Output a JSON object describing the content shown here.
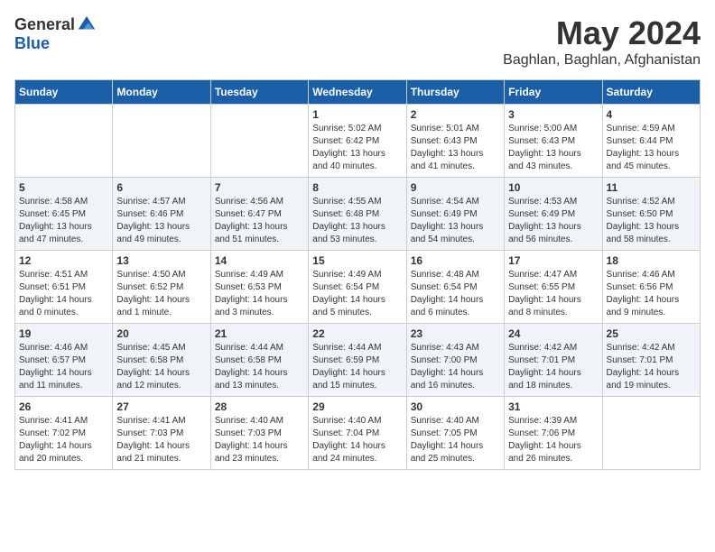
{
  "logo": {
    "general": "General",
    "blue": "Blue"
  },
  "title": "May 2024",
  "location": "Baghlan, Baghlan, Afghanistan",
  "headers": [
    "Sunday",
    "Monday",
    "Tuesday",
    "Wednesday",
    "Thursday",
    "Friday",
    "Saturday"
  ],
  "weeks": [
    [
      {
        "day": "",
        "sunrise": "",
        "sunset": "",
        "daylight": ""
      },
      {
        "day": "",
        "sunrise": "",
        "sunset": "",
        "daylight": ""
      },
      {
        "day": "",
        "sunrise": "",
        "sunset": "",
        "daylight": ""
      },
      {
        "day": "1",
        "sunrise": "Sunrise: 5:02 AM",
        "sunset": "Sunset: 6:42 PM",
        "daylight": "Daylight: 13 hours and 40 minutes."
      },
      {
        "day": "2",
        "sunrise": "Sunrise: 5:01 AM",
        "sunset": "Sunset: 6:43 PM",
        "daylight": "Daylight: 13 hours and 41 minutes."
      },
      {
        "day": "3",
        "sunrise": "Sunrise: 5:00 AM",
        "sunset": "Sunset: 6:43 PM",
        "daylight": "Daylight: 13 hours and 43 minutes."
      },
      {
        "day": "4",
        "sunrise": "Sunrise: 4:59 AM",
        "sunset": "Sunset: 6:44 PM",
        "daylight": "Daylight: 13 hours and 45 minutes."
      }
    ],
    [
      {
        "day": "5",
        "sunrise": "Sunrise: 4:58 AM",
        "sunset": "Sunset: 6:45 PM",
        "daylight": "Daylight: 13 hours and 47 minutes."
      },
      {
        "day": "6",
        "sunrise": "Sunrise: 4:57 AM",
        "sunset": "Sunset: 6:46 PM",
        "daylight": "Daylight: 13 hours and 49 minutes."
      },
      {
        "day": "7",
        "sunrise": "Sunrise: 4:56 AM",
        "sunset": "Sunset: 6:47 PM",
        "daylight": "Daylight: 13 hours and 51 minutes."
      },
      {
        "day": "8",
        "sunrise": "Sunrise: 4:55 AM",
        "sunset": "Sunset: 6:48 PM",
        "daylight": "Daylight: 13 hours and 53 minutes."
      },
      {
        "day": "9",
        "sunrise": "Sunrise: 4:54 AM",
        "sunset": "Sunset: 6:49 PM",
        "daylight": "Daylight: 13 hours and 54 minutes."
      },
      {
        "day": "10",
        "sunrise": "Sunrise: 4:53 AM",
        "sunset": "Sunset: 6:49 PM",
        "daylight": "Daylight: 13 hours and 56 minutes."
      },
      {
        "day": "11",
        "sunrise": "Sunrise: 4:52 AM",
        "sunset": "Sunset: 6:50 PM",
        "daylight": "Daylight: 13 hours and 58 minutes."
      }
    ],
    [
      {
        "day": "12",
        "sunrise": "Sunrise: 4:51 AM",
        "sunset": "Sunset: 6:51 PM",
        "daylight": "Daylight: 14 hours and 0 minutes."
      },
      {
        "day": "13",
        "sunrise": "Sunrise: 4:50 AM",
        "sunset": "Sunset: 6:52 PM",
        "daylight": "Daylight: 14 hours and 1 minute."
      },
      {
        "day": "14",
        "sunrise": "Sunrise: 4:49 AM",
        "sunset": "Sunset: 6:53 PM",
        "daylight": "Daylight: 14 hours and 3 minutes."
      },
      {
        "day": "15",
        "sunrise": "Sunrise: 4:49 AM",
        "sunset": "Sunset: 6:54 PM",
        "daylight": "Daylight: 14 hours and 5 minutes."
      },
      {
        "day": "16",
        "sunrise": "Sunrise: 4:48 AM",
        "sunset": "Sunset: 6:54 PM",
        "daylight": "Daylight: 14 hours and 6 minutes."
      },
      {
        "day": "17",
        "sunrise": "Sunrise: 4:47 AM",
        "sunset": "Sunset: 6:55 PM",
        "daylight": "Daylight: 14 hours and 8 minutes."
      },
      {
        "day": "18",
        "sunrise": "Sunrise: 4:46 AM",
        "sunset": "Sunset: 6:56 PM",
        "daylight": "Daylight: 14 hours and 9 minutes."
      }
    ],
    [
      {
        "day": "19",
        "sunrise": "Sunrise: 4:46 AM",
        "sunset": "Sunset: 6:57 PM",
        "daylight": "Daylight: 14 hours and 11 minutes."
      },
      {
        "day": "20",
        "sunrise": "Sunrise: 4:45 AM",
        "sunset": "Sunset: 6:58 PM",
        "daylight": "Daylight: 14 hours and 12 minutes."
      },
      {
        "day": "21",
        "sunrise": "Sunrise: 4:44 AM",
        "sunset": "Sunset: 6:58 PM",
        "daylight": "Daylight: 14 hours and 13 minutes."
      },
      {
        "day": "22",
        "sunrise": "Sunrise: 4:44 AM",
        "sunset": "Sunset: 6:59 PM",
        "daylight": "Daylight: 14 hours and 15 minutes."
      },
      {
        "day": "23",
        "sunrise": "Sunrise: 4:43 AM",
        "sunset": "Sunset: 7:00 PM",
        "daylight": "Daylight: 14 hours and 16 minutes."
      },
      {
        "day": "24",
        "sunrise": "Sunrise: 4:42 AM",
        "sunset": "Sunset: 7:01 PM",
        "daylight": "Daylight: 14 hours and 18 minutes."
      },
      {
        "day": "25",
        "sunrise": "Sunrise: 4:42 AM",
        "sunset": "Sunset: 7:01 PM",
        "daylight": "Daylight: 14 hours and 19 minutes."
      }
    ],
    [
      {
        "day": "26",
        "sunrise": "Sunrise: 4:41 AM",
        "sunset": "Sunset: 7:02 PM",
        "daylight": "Daylight: 14 hours and 20 minutes."
      },
      {
        "day": "27",
        "sunrise": "Sunrise: 4:41 AM",
        "sunset": "Sunset: 7:03 PM",
        "daylight": "Daylight: 14 hours and 21 minutes."
      },
      {
        "day": "28",
        "sunrise": "Sunrise: 4:40 AM",
        "sunset": "Sunset: 7:03 PM",
        "daylight": "Daylight: 14 hours and 23 minutes."
      },
      {
        "day": "29",
        "sunrise": "Sunrise: 4:40 AM",
        "sunset": "Sunset: 7:04 PM",
        "daylight": "Daylight: 14 hours and 24 minutes."
      },
      {
        "day": "30",
        "sunrise": "Sunrise: 4:40 AM",
        "sunset": "Sunset: 7:05 PM",
        "daylight": "Daylight: 14 hours and 25 minutes."
      },
      {
        "day": "31",
        "sunrise": "Sunrise: 4:39 AM",
        "sunset": "Sunset: 7:06 PM",
        "daylight": "Daylight: 14 hours and 26 minutes."
      },
      {
        "day": "",
        "sunrise": "",
        "sunset": "",
        "daylight": ""
      }
    ]
  ]
}
